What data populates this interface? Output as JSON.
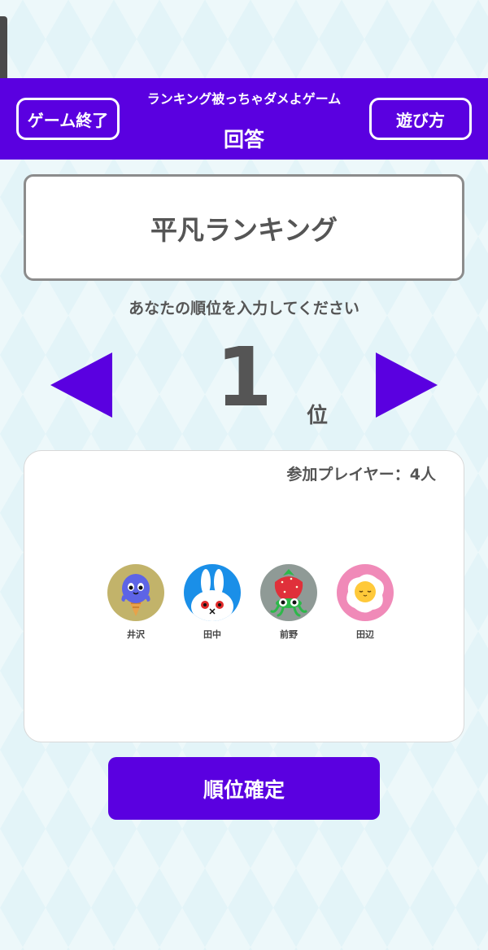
{
  "header": {
    "subtitle": "ランキング被っちゃダメよゲーム",
    "title": "回答",
    "end_button_label": "ゲーム終了",
    "howto_button_label": "遊び方",
    "accent_color": "#5a00e0"
  },
  "theme": {
    "title": "平凡ランキング"
  },
  "rank_input": {
    "prompt": "あなたの順位を入力してください",
    "value": "1",
    "unit": "位",
    "decrease_icon": "triangle-left-icon",
    "increase_icon": "triangle-right-icon"
  },
  "players": {
    "count_label": "参加プレイヤー：4人",
    "items": [
      {
        "name": "井沢",
        "avatar": "octopus-icecream-icon",
        "avatar_bg": "#c2b36a"
      },
      {
        "name": "田中",
        "avatar": "bunny-icon",
        "avatar_bg": "#1a8fe8"
      },
      {
        "name": "前野",
        "avatar": "strawberry-icon",
        "avatar_bg": "#8f9a96"
      },
      {
        "name": "田辺",
        "avatar": "fried-egg-icon",
        "avatar_bg": "#f08ab8"
      }
    ]
  },
  "confirm": {
    "label": "順位確定"
  }
}
